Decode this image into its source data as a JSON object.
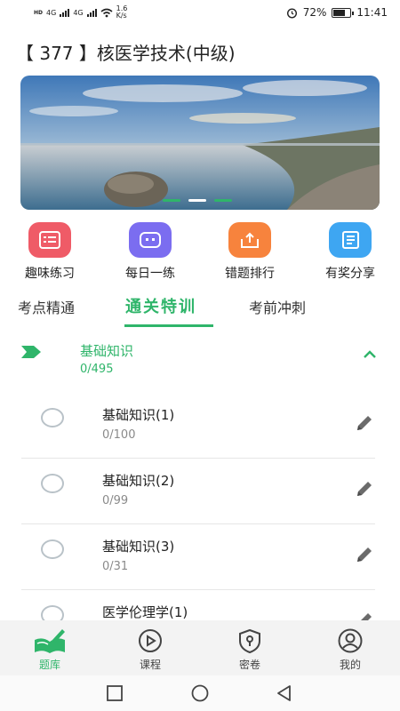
{
  "status_bar": {
    "left_indicators": [
      "HD",
      "4G",
      "4G",
      "1.6 K/s"
    ],
    "battery": "72%",
    "time": "11:41"
  },
  "page": {
    "title": "【 377 】核医学技术(中级)"
  },
  "banner": {
    "slide_count": 3,
    "active_slide": 2
  },
  "quick_actions": [
    {
      "label": "趣味练习",
      "icon": "practice-list-icon",
      "color": "#ef5b67"
    },
    {
      "label": "每日一练",
      "icon": "robot-face-icon",
      "color": "#7b6df0"
    },
    {
      "label": "错题排行",
      "icon": "share-box-icon",
      "color": "#f7833d"
    },
    {
      "label": "有奖分享",
      "icon": "notebook-icon",
      "color": "#3ea6f2"
    }
  ],
  "tabs": [
    {
      "label": "考点精通",
      "active": false
    },
    {
      "label": "通关特训",
      "active": true
    },
    {
      "label": "考前冲刺",
      "active": false
    }
  ],
  "chapter": {
    "title": "基础知识",
    "progress": "0/495",
    "expanded": true,
    "items": [
      {
        "name": "基础知识(1)",
        "progress": "0/100"
      },
      {
        "name": "基础知识(2)",
        "progress": "0/99"
      },
      {
        "name": "基础知识(3)",
        "progress": "0/31"
      },
      {
        "name": "医学伦理学(1)",
        "progress": ""
      }
    ]
  },
  "bottom_nav": [
    {
      "label": "题库",
      "icon": "question-bank-icon",
      "active": true
    },
    {
      "label": "课程",
      "icon": "play-course-icon",
      "active": false
    },
    {
      "label": "密卷",
      "icon": "secret-paper-shield-icon",
      "active": false
    },
    {
      "label": "我的",
      "icon": "user-profile-icon",
      "active": false
    }
  ],
  "colors": {
    "accent": "#2fb56a",
    "muted_text": "#8a8a8a"
  }
}
